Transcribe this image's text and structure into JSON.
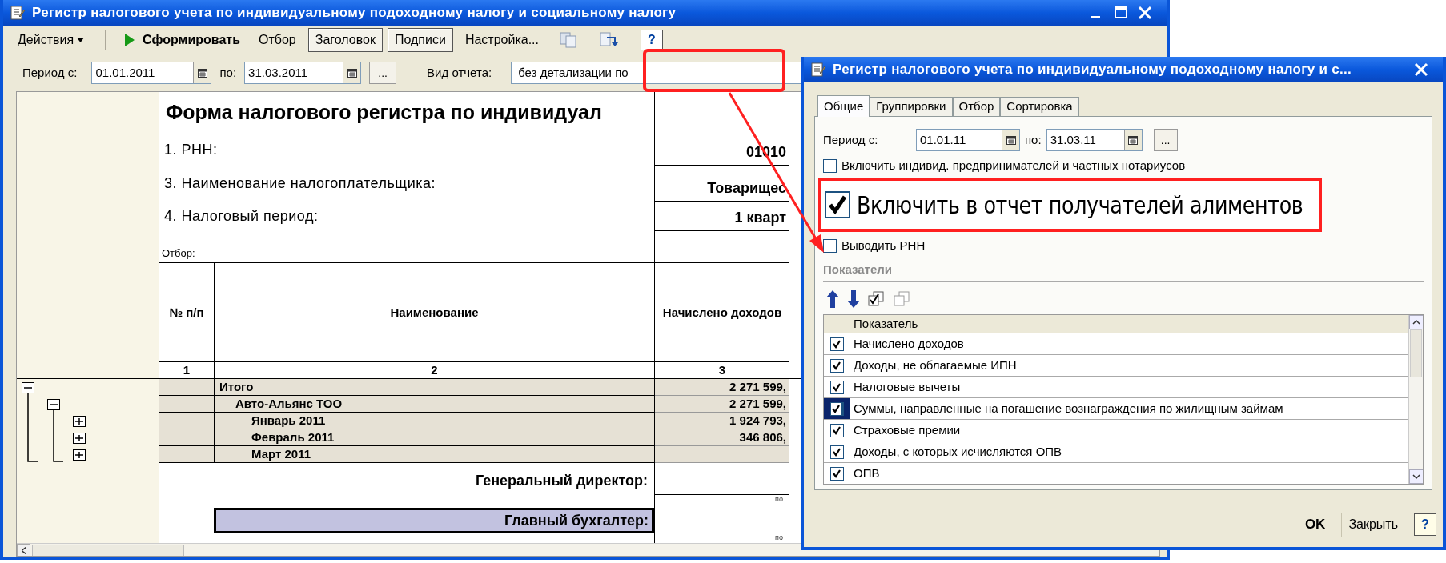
{
  "main_window": {
    "title": "Регистр налогового учета по индивидуальному подоходному налогу и социальному налогу",
    "toolbar": [
      {
        "kind": "menu",
        "label": "Действия"
      },
      {
        "kind": "run",
        "label": "Сформировать"
      },
      {
        "kind": "button",
        "label": "Отбор",
        "on": false
      },
      {
        "kind": "button",
        "label": "Заголовок",
        "on": true
      },
      {
        "kind": "button",
        "label": "Подписи",
        "on": true
      },
      {
        "kind": "button",
        "label": "Настройка...",
        "on": false
      },
      {
        "kind": "copy"
      },
      {
        "kind": "refresh"
      },
      {
        "kind": "help",
        "label": "?"
      }
    ],
    "period": {
      "from_label": "Период с:",
      "from": "01.01.2011",
      "to_label": "по:",
      "to": "31.03.2011",
      "more": "...",
      "report_type_label": "Вид отчета:",
      "report_type": "без детализации по"
    },
    "report": {
      "title": "Форма налогового регистра по индивидуал",
      "header_lines": [
        {
          "label": "1. РНН:",
          "value": "01010"
        },
        {
          "label": "3. Наименование налогоплательщика:",
          "value": "Товарищес"
        },
        {
          "label": "4. Налоговый период:",
          "value": "1 кварт"
        }
      ],
      "filter_label": "Отбор:",
      "columns": [
        "№ п/п",
        "Наименование",
        "Начислено доходов"
      ],
      "column_numbers": [
        "1",
        "2",
        "3"
      ],
      "rows": [
        {
          "name": "Итого",
          "value": "2 271 599,",
          "expanded": true,
          "children": [
            {
              "name": "Авто-Альянс ТОО",
              "value": "2 271 599,",
              "expanded": true,
              "children": [
                {
                  "name": "Январь 2011",
                  "value": "1 924 793,",
                  "expanded": false
                },
                {
                  "name": "Февраль 2011",
                  "value": "346 806,",
                  "expanded": false
                },
                {
                  "name": "Март 2011",
                  "expanded": false
                }
              ]
            }
          ]
        }
      ],
      "signatures": [
        {
          "label": "Генеральный директор:",
          "hint": "по",
          "selected": false
        },
        {
          "label": "Главный бухгалтер:",
          "hint": "по",
          "selected": true
        }
      ]
    }
  },
  "dialog": {
    "title": "Регистр налогового учета по индивидуальному подоходному налогу и с...",
    "tabs": [
      {
        "label": "Общие",
        "selected": true
      },
      {
        "label": "Группировки",
        "selected": false
      },
      {
        "label": "Отбор",
        "selected": false
      },
      {
        "label": "Сортировка",
        "selected": false
      }
    ],
    "period": {
      "from_label": "Период с:",
      "from": "01.01.11",
      "to_label": "по:",
      "to": "31.03.11",
      "more": "..."
    },
    "options": [
      {
        "label": "Включить индивид. предпринимателей и частных нотариусов",
        "checked": false,
        "highlighted": false
      },
      {
        "label": "Включить в отчет получателей алиментов",
        "checked": true,
        "highlighted": true
      },
      {
        "label": "Выводить РНН",
        "checked": false,
        "highlighted": false
      }
    ],
    "indicators": {
      "title": "Показатели",
      "column": "Показатель",
      "rows": [
        {
          "label": "Начислено доходов",
          "checked": true,
          "selected": false
        },
        {
          "label": "Доходы, не облагаемые ИПН",
          "checked": true,
          "selected": false
        },
        {
          "label": "Налоговые вычеты",
          "checked": true,
          "selected": false
        },
        {
          "label": "Суммы, направленные на погашение вознаграждения по жилищным займам",
          "checked": true,
          "selected": true
        },
        {
          "label": "Страховые премии",
          "checked": true,
          "selected": false
        },
        {
          "label": "Доходы, с которых исчисляются ОПВ",
          "checked": true,
          "selected": false
        },
        {
          "label": "ОПВ",
          "checked": true,
          "selected": false
        }
      ]
    },
    "buttons": [
      {
        "kind": "default",
        "label": "OK"
      },
      {
        "kind": "plain",
        "label": "Закрыть"
      },
      {
        "kind": "help",
        "label": "?"
      }
    ]
  }
}
